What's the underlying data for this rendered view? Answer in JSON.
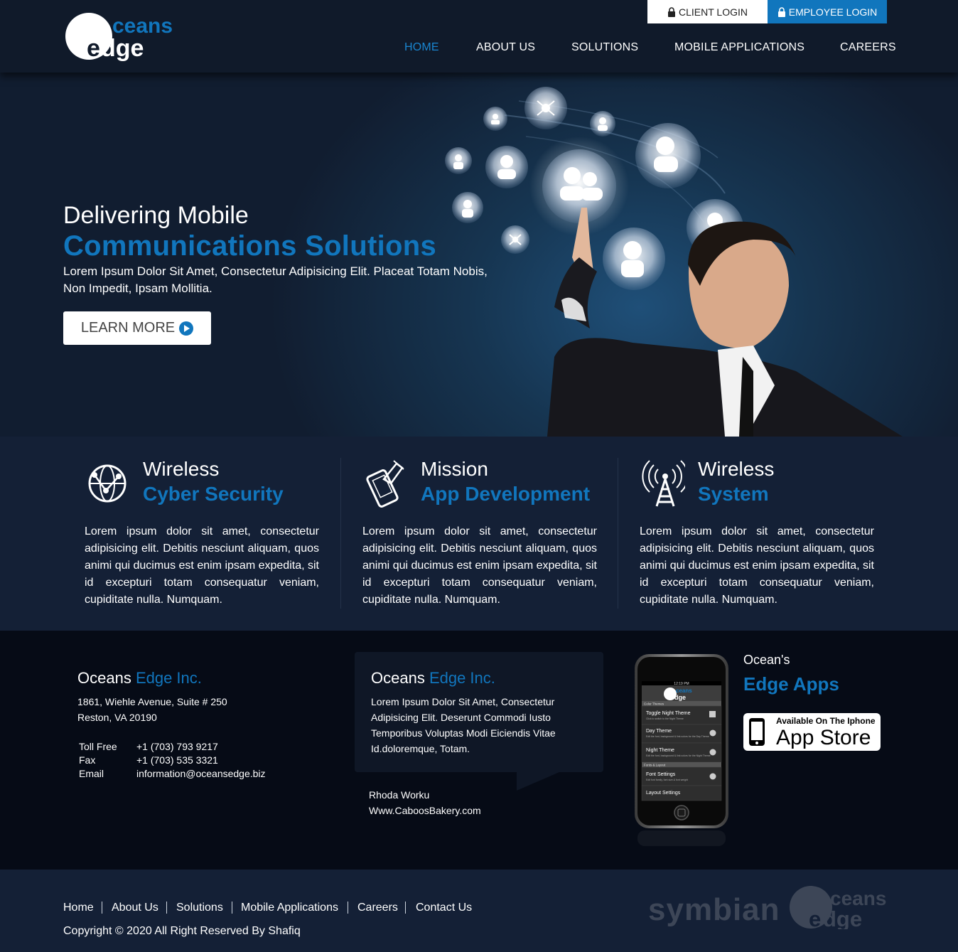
{
  "header": {
    "logo": {
      "line1": "ceans",
      "line2": "dge"
    },
    "client_login": "CLIENT LOGIN",
    "employee_login": "EMPLOYEE LOGIN",
    "nav": [
      {
        "label": "HOME",
        "active": true
      },
      {
        "label": "ABOUT US"
      },
      {
        "label": "SOLUTIONS"
      },
      {
        "label": "MOBILE APPLICATIONS"
      },
      {
        "label": "CAREERS"
      }
    ],
    "accent_color": "#1176bd"
  },
  "hero": {
    "line1": "Delivering Mobile",
    "line2": "Communications Solutions",
    "paragraph": "Lorem Ipsum Dolor Sit Amet, Consectetur Adipisicing Elit. Placeat Totam Nobis, Non Impedit, Ipsam Mollitia.",
    "button": "LEARN MORE"
  },
  "features": [
    {
      "icon": "globe-network-icon",
      "title1": "Wireless",
      "title2": "Cyber Security",
      "text": "Lorem ipsum dolor sit amet, consectetur adipisicing elit. Debitis nesciunt aliquam, quos animi qui ducimus est enim ipsam expedita, sit id excepturi totam consequatur veniam, cupiditate nulla. Numquam."
    },
    {
      "icon": "phone-touch-icon",
      "title1": "Mission",
      "title2": "App Development",
      "text": "Lorem ipsum dolor sit amet, consectetur adipisicing elit. Debitis nesciunt aliquam, quos animi qui ducimus est enim ipsam expedita, sit id excepturi totam consequatur veniam, cupiditate nulla. Numquam."
    },
    {
      "icon": "radio-tower-icon",
      "title1": "Wireless",
      "title2": "System",
      "text": "Lorem ipsum dolor sit amet, consectetur adipisicing elit. Debitis nesciunt aliquam, quos animi qui ducimus est enim ipsam expedita, sit id excepturi totam consequatur veniam, cupiditate nulla. Numquam."
    }
  ],
  "contact": {
    "title_a": "Oceans ",
    "title_b": "Edge Inc.",
    "address1": "1861, Wiehle Avenue, Suite # 250",
    "address2": "Reston, VA 20190",
    "rows": [
      {
        "label": "Toll Free",
        "value": "+1 (703) 793 9217"
      },
      {
        "label": "Fax",
        "value": "+1 (703) 535 3321"
      },
      {
        "label": "Email",
        "value": "information@oceansedge.biz"
      }
    ]
  },
  "testimonial": {
    "title_a": "Oceans ",
    "title_b": "Edge Inc.",
    "text": "Lorem Ipsum Dolor Sit Amet, Consectetur Adipisicing Elit. Deserunt Commodi Iusto Temporibus Voluptas Modi Eiciendis Vitae Id.doloremque, Totam.",
    "author": "Rhoda Worku",
    "site": "Www.CaboosBakery.com"
  },
  "apps": {
    "label1": "Ocean's",
    "label2": "Edge Apps",
    "store_top": "Available On The Iphone",
    "store_main": "App Store",
    "phone_screen": {
      "time": "12:19 PM",
      "header": "Color Themes",
      "items": [
        {
          "title": "Toggle Night Theme",
          "sub": "Click to switch to the Night Theme"
        },
        {
          "title": "Day Theme",
          "sub": "Edit the font, background & link colors for the Day Theme"
        },
        {
          "title": "Night Theme",
          "sub": "Edit the font, background & link colors for the Night Theme"
        }
      ],
      "section2": "Fonts & Layout",
      "items2": [
        {
          "title": "Font Settings",
          "sub": "Edit font family, font size & font weight"
        },
        {
          "title": "Layout Settings",
          "sub": ""
        }
      ]
    }
  },
  "footer": {
    "links": [
      "Home",
      "About Us",
      "Solutions",
      "Mobile Applications",
      "Careers",
      "Contact Us"
    ],
    "copyright": "Copyright © 2020 All Right Reserved By Shafiq",
    "partner_logo": "symbian"
  }
}
